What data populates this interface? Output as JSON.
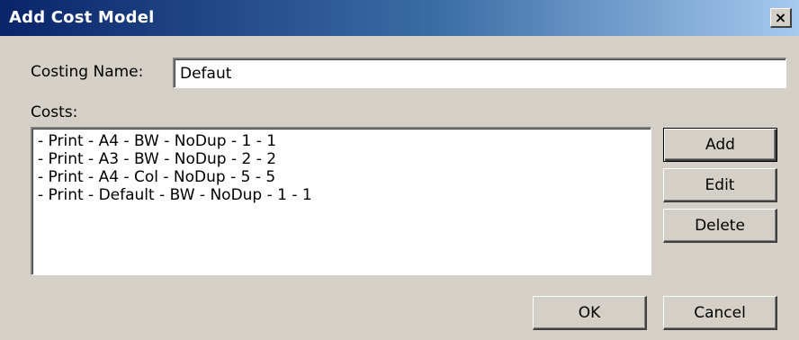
{
  "window": {
    "title": "Add Cost Model",
    "close_glyph": "×"
  },
  "form": {
    "costing_name_label": "Costing Name:",
    "costing_name_value": "Defaut",
    "costs_label": "Costs:"
  },
  "costs": [
    "- Print - A4 - BW - NoDup - 1 - 1",
    "- Print - A3 - BW - NoDup - 2 - 2",
    "- Print - A4 - Col - NoDup - 5 - 5",
    "- Print - Default - BW - NoDup - 1 - 1"
  ],
  "buttons": {
    "add": "Add",
    "edit": "Edit",
    "delete": "Delete",
    "ok": "OK",
    "cancel": "Cancel"
  },
  "icons": {
    "close": "close-icon"
  },
  "colors": {
    "titlebar_start": "#0a246a",
    "titlebar_end": "#a6caf0",
    "dialog_bg": "#d4d0c8"
  }
}
